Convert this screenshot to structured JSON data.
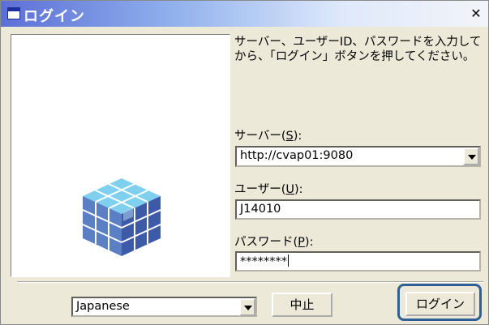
{
  "window": {
    "title": "ログイン",
    "close_icon": "close-icon"
  },
  "instructions": "サーバー、ユーザーID、パスワードを入力してから、「ログイン」ボタンを押してください。",
  "server": {
    "label": "サーバー(",
    "accel": "S",
    "label_end": "):",
    "value": "http://cvap01:9080"
  },
  "user": {
    "label": "ユーザー(",
    "accel": "U",
    "label_end": "):",
    "value": "J14010"
  },
  "password": {
    "label": "パスワード(",
    "accel": "P",
    "label_end": "):",
    "value": "********"
  },
  "language": {
    "value": "Japanese"
  },
  "buttons": {
    "cancel": "中止",
    "login": "ログイン"
  },
  "colors": {
    "title_gradient_start": "#5c6fd6",
    "focus_ring": "#2e5f99"
  }
}
